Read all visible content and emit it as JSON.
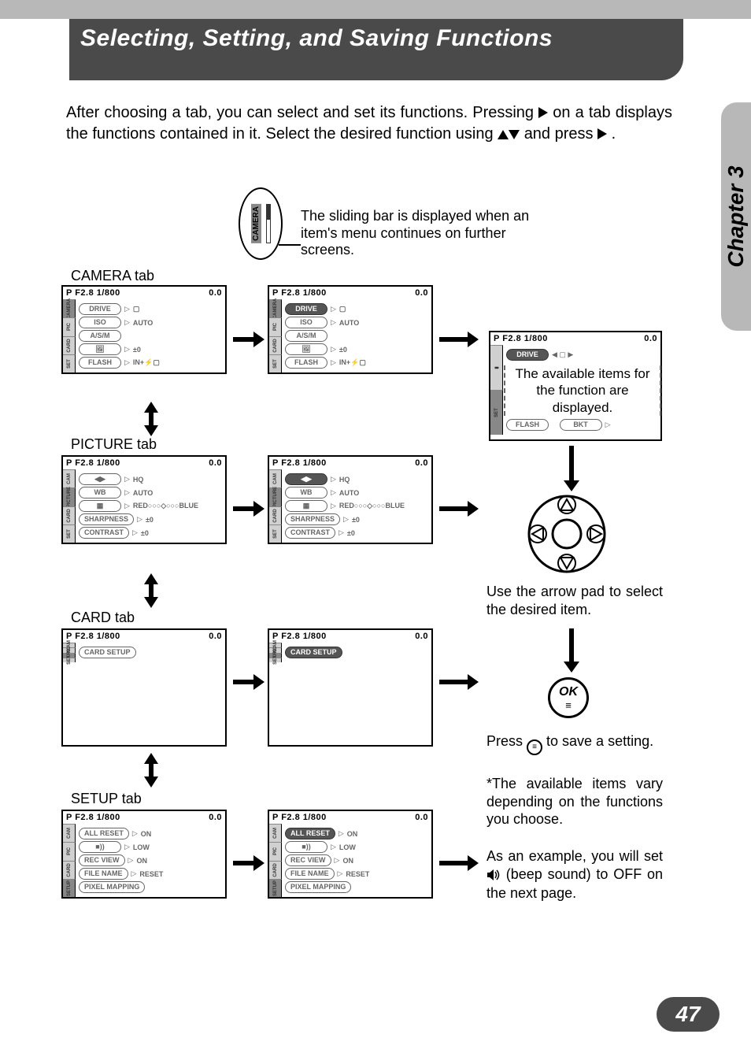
{
  "title": "Selecting, Setting, and Saving Functions",
  "chapter": "Chapter 3",
  "page_number": "47",
  "intro_pre": "After choosing a tab, you can select and set its functions. Pressing ",
  "intro_mid": " on a tab displays the functions contained in it. Select the desired function using ",
  "intro_post": " and press ",
  "intro_end": ".",
  "callout": "The sliding bar is displayed when an item's menu continues on further screens.",
  "bubble_label": "CAMERA",
  "tab_labels": {
    "camera": "CAMERA tab",
    "picture": "PICTURE tab",
    "card": "CARD tab",
    "setup": "SETUP tab"
  },
  "tab_side": {
    "cam": "CAM",
    "camera": "CAMERA",
    "pic": "PIC",
    "picture": "PICTURE",
    "card": "CARD",
    "set": "SET",
    "setup": "SETUP"
  },
  "status_line": {
    "mode": "P",
    "aperture": "F2.8",
    "shutter": "1/800",
    "ev": "0.0"
  },
  "camera_menu": {
    "items": [
      {
        "label": "DRIVE",
        "value": "▢"
      },
      {
        "label": "ISO",
        "value": "AUTO"
      },
      {
        "label": "A/S/M",
        "value": ""
      },
      {
        "label": "🖼",
        "value": "±0"
      },
      {
        "label": "FLASH",
        "value": "IN+⚡▢"
      }
    ]
  },
  "picture_menu": {
    "items": [
      {
        "label": "◀▶",
        "value": "HQ"
      },
      {
        "label": "WB",
        "value": "AUTO"
      },
      {
        "label": "▦",
        "value": "RED○○○◇○○○BLUE"
      },
      {
        "label": "SHARPNESS",
        "value": "±0"
      },
      {
        "label": "CONTRAST",
        "value": "±0"
      }
    ]
  },
  "card_menu": {
    "items": [
      {
        "label": "CARD SETUP",
        "value": ""
      }
    ]
  },
  "setup_menu": {
    "items": [
      {
        "label": "ALL RESET",
        "value": "ON"
      },
      {
        "label": "■))",
        "value": "LOW"
      },
      {
        "label": "REC VIEW",
        "value": "ON"
      },
      {
        "label": "FILE NAME",
        "value": "RESET"
      },
      {
        "label": "PIXEL MAPPING",
        "value": ""
      }
    ]
  },
  "drive_screen_note": "The available items for the function are displayed.",
  "drive_screen_labels": {
    "drive": "DRIVE",
    "flash": "FLASH",
    "bkt": "BKT"
  },
  "arrowpad_text": "Use the arrow pad to select the desired item.",
  "ok_label": "OK",
  "press_save_pre": "Press ",
  "press_save_post": " to save a setting.",
  "vary_note": "*The available items vary depending on the functions you choose.",
  "example_pre": "As an example, you will set ",
  "example_post": " (beep sound) to OFF on the next page."
}
